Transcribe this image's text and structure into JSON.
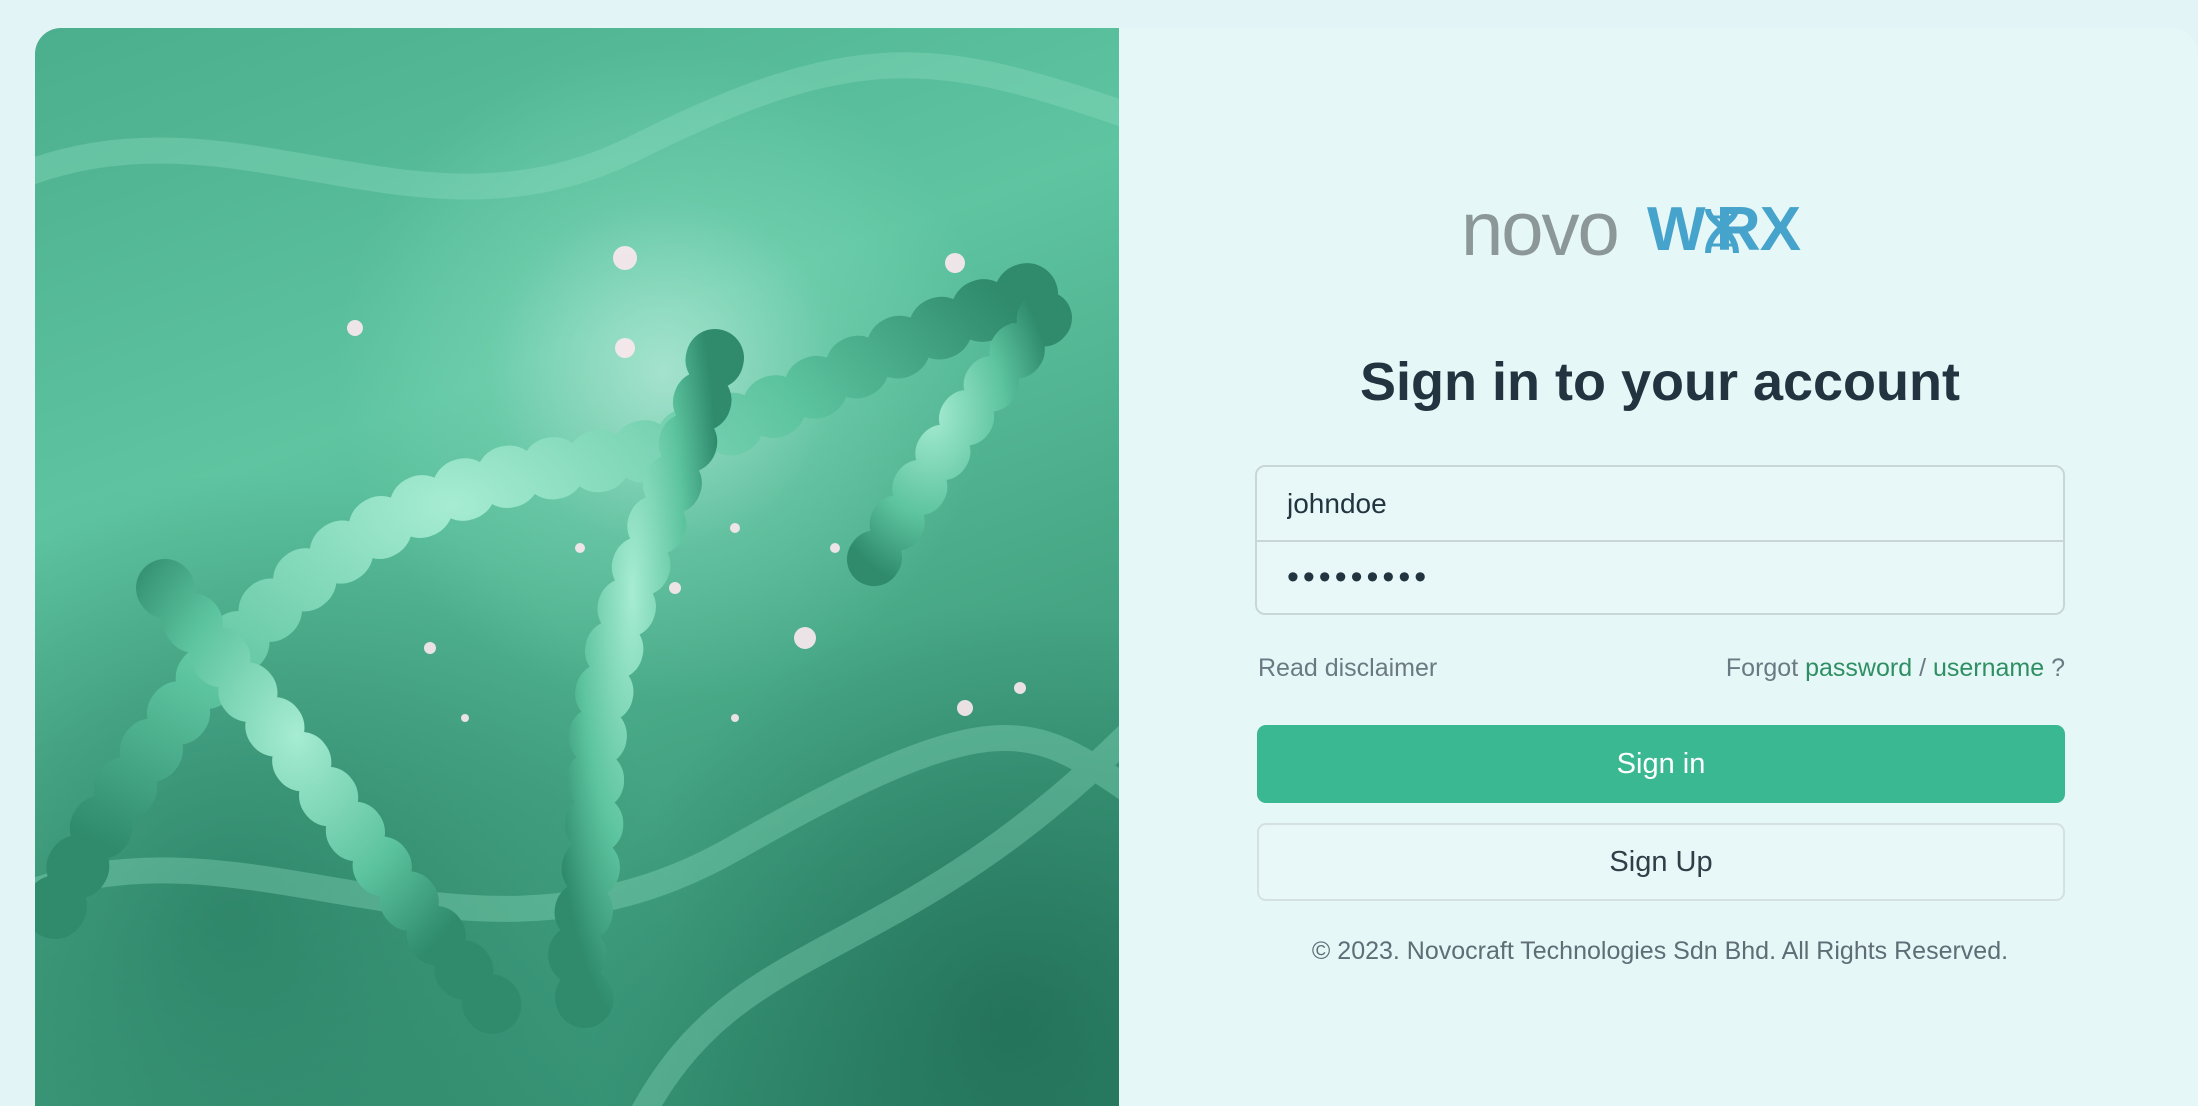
{
  "brand": {
    "logo_light": "novo",
    "logo_bold": "W RX",
    "logo_light_color": "#8c9897",
    "logo_bold_color": "#46a3cc"
  },
  "login": {
    "heading": "Sign in to your account",
    "username_value": "johndoe",
    "password_value": "•••••••••",
    "read_disclaimer": "Read disclaimer",
    "forgot_prefix": "Forgot",
    "forgot_password": "password",
    "forgot_separator": "/",
    "forgot_username": "username",
    "forgot_suffix": "?",
    "signin_label": "Sign in",
    "signup_label": "Sign Up",
    "copyright": "© 2023. Novocraft Technologies Sdn Bhd. All Rights Reserved."
  },
  "colors": {
    "accent": "#3ab892",
    "link": "#2e8f63",
    "heading": "#22343f",
    "background": "#e6f7f7"
  },
  "icons": {
    "hero": "dna-helix-image",
    "logo_o": "dna-helix-icon"
  }
}
